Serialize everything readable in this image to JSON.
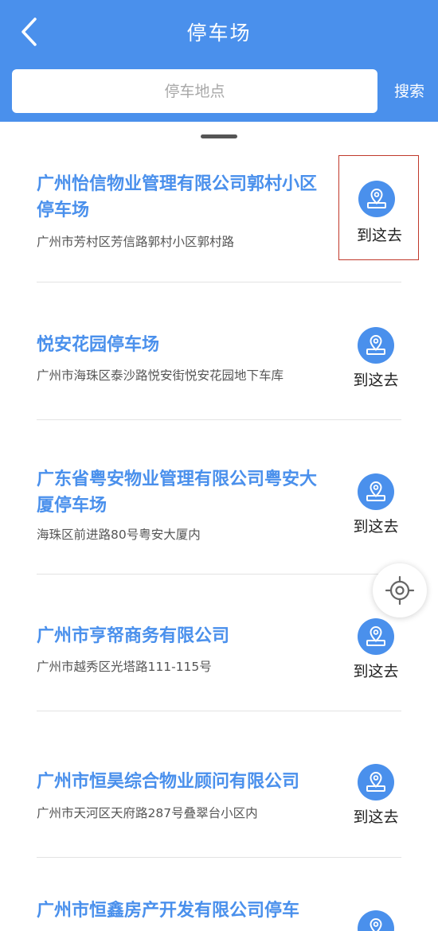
{
  "header": {
    "title": "停车场",
    "back_icon": "chevron-left-icon",
    "bg_color": "#4a90ec"
  },
  "search": {
    "placeholder": "停车地点",
    "value": "",
    "button_label": "搜索"
  },
  "items": [
    {
      "name": "广州怡信物业管理有限公司郭村小区停车场",
      "address": "广州市芳村区芳信路郭村小区郭村路",
      "go_label": "到这去",
      "go_icon": "map-pin-icon"
    },
    {
      "name": "悦安花园停车场",
      "address": "广州市海珠区泰沙路悦安街悦安花园地下车库",
      "go_label": "到这去",
      "go_icon": "map-pin-icon"
    },
    {
      "name": "广东省粤安物业管理有限公司粤安大厦停车场",
      "address": "海珠区前进路80号粤安大厦内",
      "go_label": "到这去",
      "go_icon": "map-pin-icon"
    },
    {
      "name": "广州市亨帑商务有限公司",
      "address": "广州市越秀区光塔路111-115号",
      "go_label": "到这去",
      "go_icon": "map-pin-icon"
    },
    {
      "name": "广州市恒昊综合物业顾问有限公司",
      "address": "广州市天河区天府路287号叠翠台小区内",
      "go_label": "到这去",
      "go_icon": "map-pin-icon"
    },
    {
      "name": "广州市恒鑫房产开发有限公司停车",
      "address": "",
      "go_label": "",
      "go_icon": "map-pin-icon"
    }
  ],
  "locate_icon": "crosshair-locate-icon",
  "accent_color": "#4a90ec"
}
